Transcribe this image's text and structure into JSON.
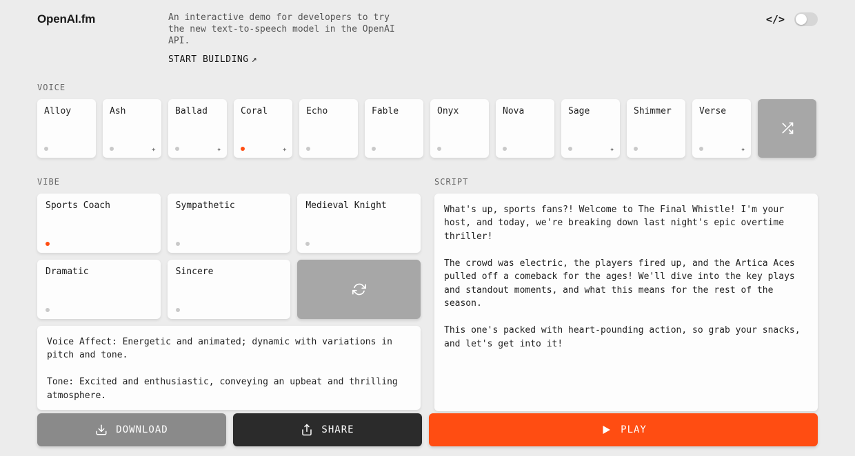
{
  "header": {
    "logo": "OpenAI.fm",
    "intro": "An interactive demo for developers to try the new text-to-speech model in the OpenAI API.",
    "start_building": "START BUILDING",
    "code_icon": "</>"
  },
  "sections": {
    "voice_label": "VOICE",
    "vibe_label": "VIBE",
    "script_label": "SCRIPT"
  },
  "voices": [
    {
      "name": "Alloy",
      "sparkle": false,
      "selected": false
    },
    {
      "name": "Ash",
      "sparkle": true,
      "selected": false
    },
    {
      "name": "Ballad",
      "sparkle": true,
      "selected": false
    },
    {
      "name": "Coral",
      "sparkle": true,
      "selected": true
    },
    {
      "name": "Echo",
      "sparkle": false,
      "selected": false
    },
    {
      "name": "Fable",
      "sparkle": false,
      "selected": false
    },
    {
      "name": "Onyx",
      "sparkle": false,
      "selected": false
    },
    {
      "name": "Nova",
      "sparkle": false,
      "selected": false
    },
    {
      "name": "Sage",
      "sparkle": true,
      "selected": false
    },
    {
      "name": "Shimmer",
      "sparkle": false,
      "selected": false
    },
    {
      "name": "Verse",
      "sparkle": true,
      "selected": false
    }
  ],
  "vibes": [
    {
      "name": "Sports Coach",
      "selected": true
    },
    {
      "name": "Sympathetic",
      "selected": false
    },
    {
      "name": "Medieval Knight",
      "selected": false
    },
    {
      "name": "Dramatic",
      "selected": false
    },
    {
      "name": "Sincere",
      "selected": false
    }
  ],
  "vibe_description": "Voice Affect: Energetic and animated; dynamic with variations in pitch and tone.\n\nTone: Excited and enthusiastic, conveying an upbeat and thrilling atmosphere.\n\nPacing: Rapid delivery when describing the game or the key moments (e.g.,",
  "script_text": "What's up, sports fans?! Welcome to The Final Whistle! I'm your host, and today, we're breaking down last night's epic overtime thriller!\n\nThe crowd was electric, the players fired up, and the Artica Aces pulled off a comeback for the ages! We'll dive into the key plays and standout moments, and what this means for the rest of the season.\n\nThis one's packed with heart-pounding action, so grab your snacks, and let's get into it!",
  "actions": {
    "download": "DOWNLOAD",
    "share": "SHARE",
    "play": "PLAY"
  },
  "icons": {
    "sparkle_glyph": "✦"
  }
}
